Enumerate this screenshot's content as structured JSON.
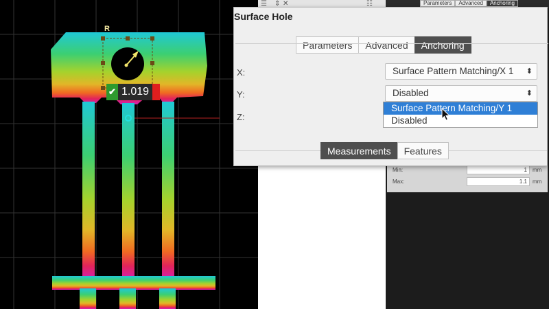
{
  "viewport": {
    "hole_label": "R",
    "measurement_value": "1.019",
    "measurement_status": "pass"
  },
  "toolbar": {
    "mini_tabs": [
      "Parameters",
      "Advanced",
      "Anchoring"
    ],
    "active_mini_tab": "Anchoring"
  },
  "limits": {
    "min_label": "Min:",
    "min_value": "1",
    "min_unit": "mm",
    "max_label": "Max:",
    "max_value": "1.1",
    "max_unit": "mm"
  },
  "dialog": {
    "title": "Surface Hole",
    "tabs": [
      "Parameters",
      "Advanced",
      "Anchoring"
    ],
    "active_tab": "Anchoring",
    "fields": {
      "x": {
        "label": "X:",
        "value": "Surface Pattern Matching/X 1"
      },
      "y": {
        "label": "Y:",
        "value": "Disabled"
      },
      "z": {
        "label": "Z:"
      }
    },
    "dropdown_options": [
      "Surface Pattern Matching/Y 1",
      "Disabled"
    ],
    "highlighted_option": "Surface Pattern Matching/Y 1",
    "bottom_tabs": [
      "Measurements",
      "Features"
    ],
    "active_bottom_tab": "Measurements"
  },
  "colors": {
    "selected_blue": "#2f7fd6",
    "pass_green": "#2e9a2e",
    "fail_red": "#e01e1e",
    "active_tab": "#4f4f4f"
  }
}
